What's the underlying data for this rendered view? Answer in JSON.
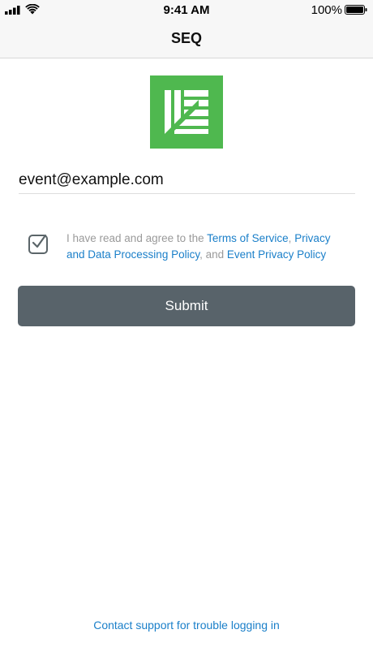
{
  "status_bar": {
    "time": "9:41 AM",
    "battery_percent": "100%",
    "battery_level": 1.0,
    "signal_icon": "cellular-signal-icon",
    "wifi_icon": "wifi-icon",
    "battery_icon": "battery-icon"
  },
  "nav": {
    "title": "SEQ"
  },
  "logo": {
    "icon": "seq-leaf-logo",
    "color": "#4fb84f"
  },
  "form": {
    "email_value": "event@example.com",
    "agreement_checked": true,
    "agreement": {
      "prefix": "I have read and agree to the ",
      "terms_link": "Terms of Service",
      "sep1": ", ",
      "privacy_link": "Privacy and Data Processing Policy",
      "sep2": ", and ",
      "event_link": "Event Privacy Policy"
    },
    "submit_label": "Submit"
  },
  "footer": {
    "support_link": "Contact support for trouble logging in"
  },
  "colors": {
    "link": "#1a7fc9",
    "button": "#58636a",
    "brand_green": "#4fb84f"
  }
}
